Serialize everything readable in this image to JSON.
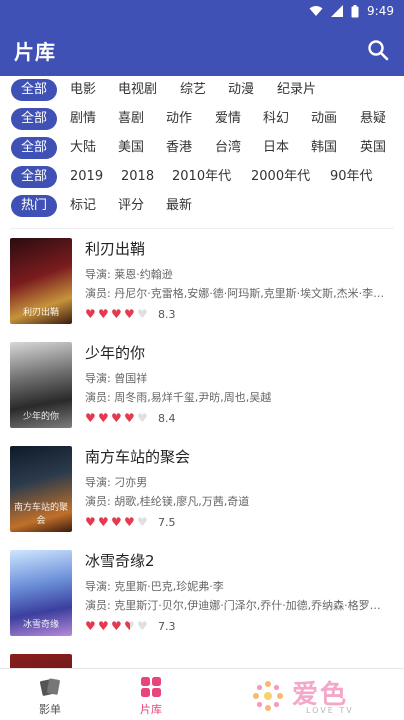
{
  "status_bar": {
    "time": "9:49",
    "icons": [
      "wifi-icon",
      "signal-icon",
      "battery-icon"
    ]
  },
  "app_bar": {
    "title": "片库",
    "search_icon": "search-icon"
  },
  "filters": {
    "chip_label": "全部",
    "hot_label": "热门",
    "type": [
      "电影",
      "电视剧",
      "综艺",
      "动漫",
      "纪录片"
    ],
    "genre": [
      "剧情",
      "喜剧",
      "动作",
      "爱情",
      "科幻",
      "动画",
      "悬疑"
    ],
    "region": [
      "大陆",
      "美国",
      "香港",
      "台湾",
      "日本",
      "韩国",
      "英国"
    ],
    "year": [
      "2019",
      "2018",
      "2010年代",
      "2000年代",
      "90年代"
    ],
    "sort": [
      "标记",
      "评分",
      "最新"
    ]
  },
  "movies": [
    {
      "title": "利刃出鞘",
      "director": "导演: 莱恩·约翰逊",
      "cast": "演员: 丹尼尔·克雷格,安娜·德·阿玛斯,克里斯·埃文斯,杰米·李…",
      "score": "8.3",
      "rating": 4,
      "poster_text": "利刃出鞘"
    },
    {
      "title": "少年的你",
      "director": "导演: 曾国祥",
      "cast": "演员: 周冬雨,易烊千玺,尹昉,周也,吴越",
      "score": "8.4",
      "rating": 4,
      "poster_text": "少年的你"
    },
    {
      "title": "南方车站的聚会",
      "director": "导演: 刁亦男",
      "cast": "演员: 胡歌,桂纶镁,廖凡,万茜,奇道",
      "score": "7.5",
      "rating": 4,
      "poster_text": "南方车站的聚会"
    },
    {
      "title": "冰雪奇缘2",
      "director": "导演: 克里斯·巴克,珍妮弗·李",
      "cast": "演员: 克里斯汀·贝尔,伊迪娜·门泽尔,乔什·加德,乔纳森·格罗…",
      "score": "7.3",
      "rating": 3.5,
      "poster_text": "冰雪奇缘"
    }
  ],
  "bottom_nav": [
    {
      "label": "影单",
      "icon": "cards-icon",
      "active": false
    },
    {
      "label": "片库",
      "icon": "grid-icon",
      "active": true
    }
  ],
  "watermark": {
    "big": "爱色",
    "small": "LOVE TV"
  },
  "colors": {
    "primary": "#3f51b5",
    "accent": "#e53950",
    "active_tab": "#e8457a"
  }
}
